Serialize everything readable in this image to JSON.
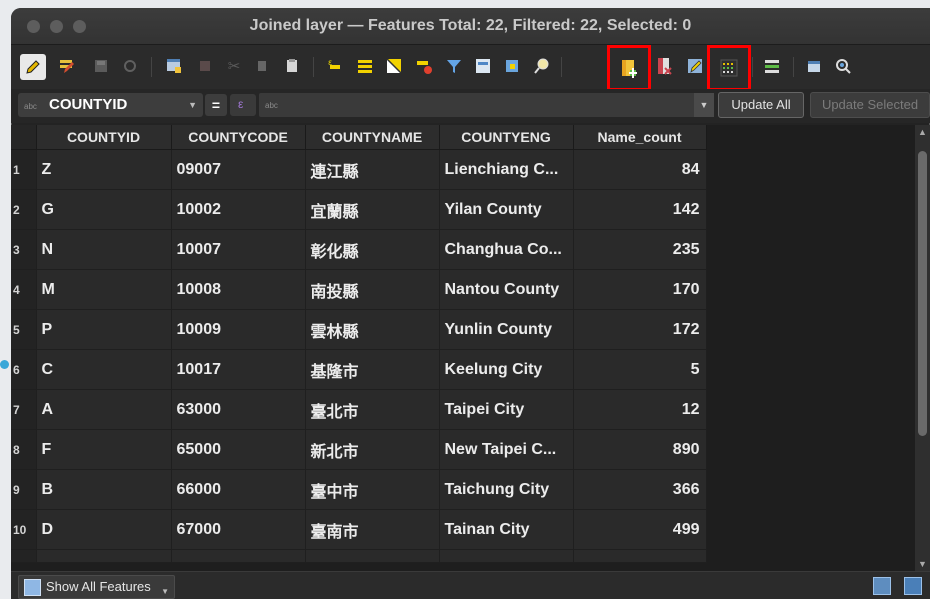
{
  "window": {
    "title": "Joined layer — Features Total: 22, Filtered: 22, Selected: 0"
  },
  "toolbar": {
    "icons": [
      "pencil-edit-icon",
      "multi-edit-icon",
      "save-edits-icon",
      "reload-icon",
      "add-feature-icon",
      "delete-feature-icon",
      "cut-icon",
      "copy-icon",
      "paste-icon",
      "select-by-expression-icon",
      "select-all-icon",
      "invert-selection-icon",
      "deselect-all-icon",
      "filter-select-icon",
      "move-selection-to-top-icon",
      "pan-to-selection-icon",
      "zoom-to-selection-icon",
      "new-field-icon",
      "delete-field-icon",
      "field-calculator-icon",
      "conditional-formatting-icon",
      "dock-table-icon",
      "actions-icon",
      "zoom-map-icon"
    ],
    "highlighted": [
      "new-field-icon",
      "conditional-formatting-icon"
    ]
  },
  "fieldbar": {
    "type_tag": "abc",
    "field": "COUNTYID",
    "equals": "=",
    "expression_type_tag": "abc",
    "update_all": "Update All",
    "update_selected": "Update Selected"
  },
  "table": {
    "columns": [
      "COUNTYID",
      "COUNTYCODE",
      "COUNTYNAME",
      "COUNTYENG",
      "Name_count"
    ],
    "rows": [
      {
        "n": "1",
        "id": "Z",
        "code": "09007",
        "name": "連江縣",
        "eng": "Lienchiang C...",
        "count": "84"
      },
      {
        "n": "2",
        "id": "G",
        "code": "10002",
        "name": "宜蘭縣",
        "eng": "Yilan County",
        "count": "142"
      },
      {
        "n": "3",
        "id": "N",
        "code": "10007",
        "name": "彰化縣",
        "eng": "Changhua Co...",
        "count": "235"
      },
      {
        "n": "4",
        "id": "M",
        "code": "10008",
        "name": "南投縣",
        "eng": "Nantou County",
        "count": "170"
      },
      {
        "n": "5",
        "id": "P",
        "code": "10009",
        "name": "雲林縣",
        "eng": "Yunlin County",
        "count": "172"
      },
      {
        "n": "6",
        "id": "C",
        "code": "10017",
        "name": "基隆市",
        "eng": "Keelung City",
        "count": "5"
      },
      {
        "n": "7",
        "id": "A",
        "code": "63000",
        "name": "臺北市",
        "eng": "Taipei City",
        "count": "12"
      },
      {
        "n": "8",
        "id": "F",
        "code": "65000",
        "name": "新北市",
        "eng": "New Taipei C...",
        "count": "890"
      },
      {
        "n": "9",
        "id": "B",
        "code": "66000",
        "name": "臺中市",
        "eng": "Taichung City",
        "count": "366"
      },
      {
        "n": "10",
        "id": "D",
        "code": "67000",
        "name": "臺南市",
        "eng": "Tainan City",
        "count": "499"
      }
    ]
  },
  "bottombar": {
    "show_all": "Show All Features"
  },
  "colors": {
    "highlight": "#ff0000",
    "window_bg": "#232323",
    "cell_bg": "#2a2a2a"
  }
}
